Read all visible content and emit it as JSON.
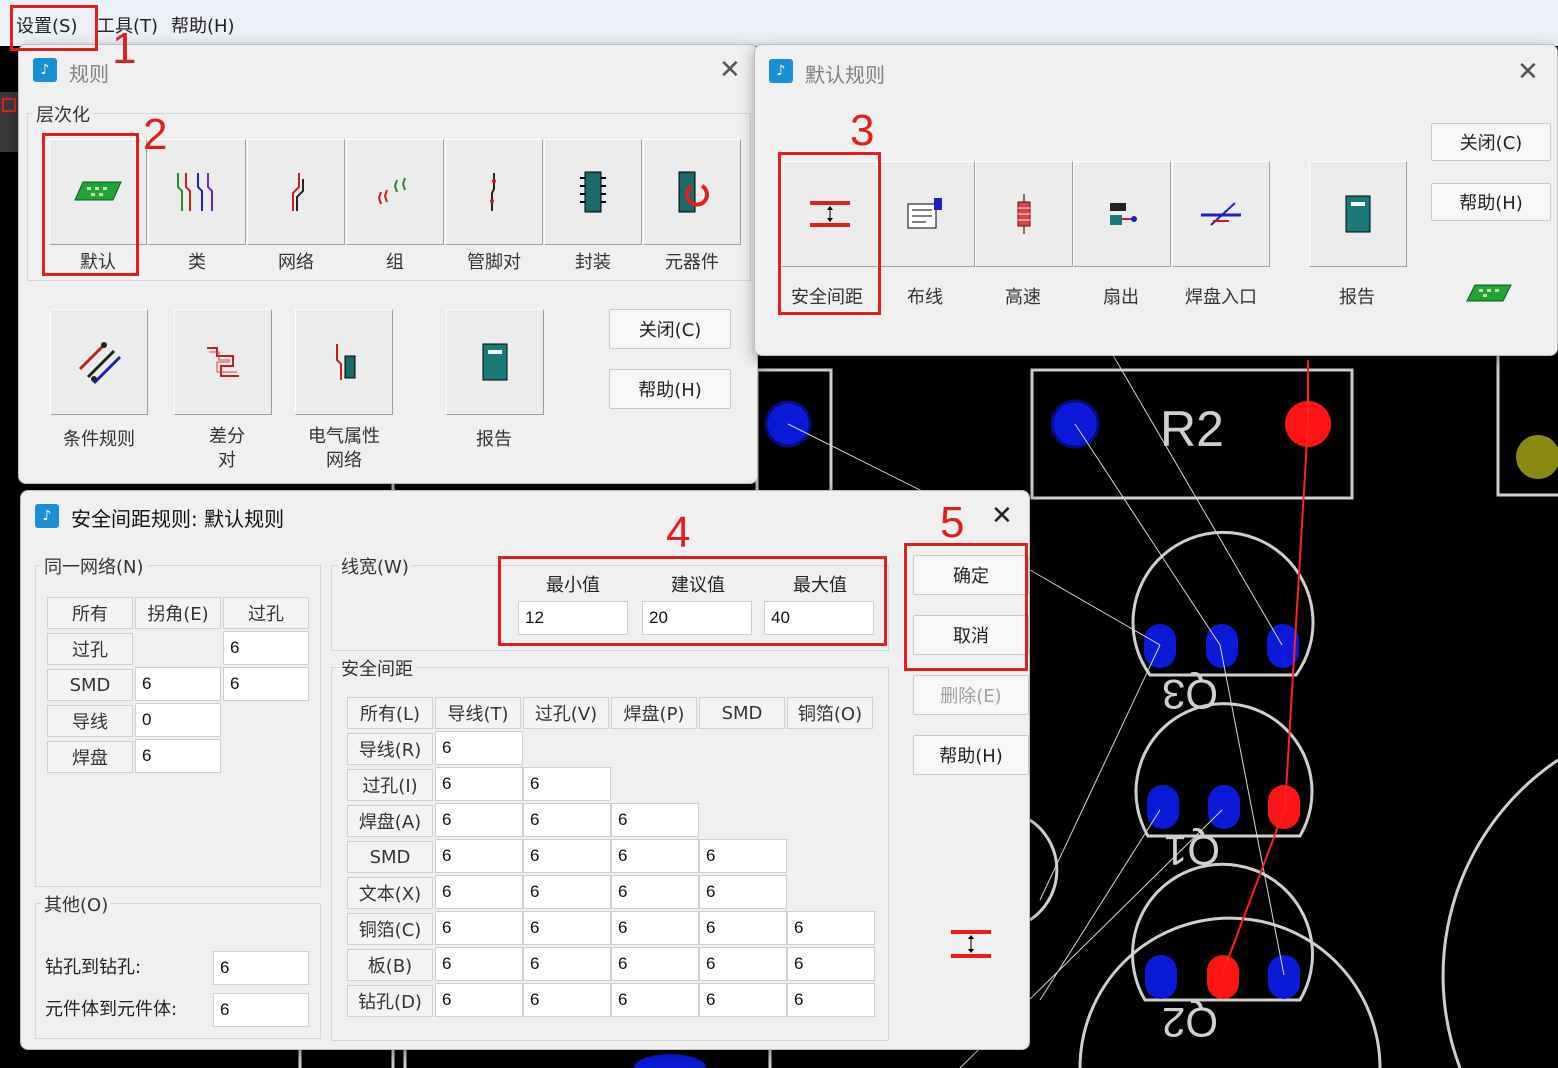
{
  "menubar": {
    "items": [
      "设置(S)",
      "工具(T)",
      "帮助(H)"
    ]
  },
  "annotations": {
    "steps": [
      "1",
      "2",
      "3",
      "4",
      "5"
    ]
  },
  "pcb": {
    "labels": [
      "R2",
      "Q3",
      "Q1",
      "Q2"
    ],
    "colors": {
      "pad_blue": "#0b1ad8",
      "pad_red": "#ff1414",
      "outline": "#cfcfcf",
      "trace_red": "#ff2020"
    }
  },
  "rules_window": {
    "title": "规则",
    "group_label": "层次化",
    "tiles_row1": [
      "默认",
      "类",
      "网络",
      "组",
      "管脚对",
      "封装",
      "元器件"
    ],
    "tiles_row2": [
      "条件规则",
      "差分\n对",
      "电气属性\n网络",
      "报告"
    ],
    "close_button": "关闭(C)",
    "help_button": "帮助(H)"
  },
  "default_rules_window": {
    "title": "默认规则",
    "tiles": [
      "安全间距",
      "布线",
      "高速",
      "扇出",
      "焊盘入口",
      "报告"
    ],
    "close_button": "关闭(C)",
    "help_button": "帮助(H)"
  },
  "clearance_dialog": {
    "title": "安全间距规则: 默认规则",
    "same_net": {
      "label": "同一网络(N)",
      "headers": [
        "所有",
        "拐角(E)",
        "过孔"
      ],
      "rows": [
        {
          "label": "过孔",
          "values": [
            "",
            "6"
          ]
        },
        {
          "label": "SMD",
          "values": [
            "6",
            "6"
          ]
        },
        {
          "label": "导线",
          "values": [
            "0",
            ""
          ]
        },
        {
          "label": "焊盘",
          "values": [
            "6",
            ""
          ]
        }
      ]
    },
    "other": {
      "label": "其他(O)",
      "drill_to_drill_label": "钻孔到钻孔:",
      "drill_to_drill": "6",
      "body_to_body_label": "元件体到元件体:",
      "body_to_body": "6"
    },
    "trace_width": {
      "label": "线宽(W)",
      "min_label": "最小值",
      "rec_label": "建议值",
      "max_label": "最大值",
      "min": "12",
      "rec": "20",
      "max": "40"
    },
    "clearance": {
      "label": "安全间距",
      "headers": [
        "所有(L)",
        "导线(T)",
        "过孔(V)",
        "焊盘(P)",
        "SMD",
        "铜箔(O)"
      ],
      "rows": [
        {
          "label": "导线(R)",
          "values": [
            "6"
          ]
        },
        {
          "label": "过孔(I)",
          "values": [
            "6",
            "6"
          ]
        },
        {
          "label": "焊盘(A)",
          "values": [
            "6",
            "6",
            "6"
          ]
        },
        {
          "label": "SMD",
          "values": [
            "6",
            "6",
            "6",
            "6"
          ]
        },
        {
          "label": "文本(X)",
          "values": [
            "6",
            "6",
            "6",
            "6"
          ]
        },
        {
          "label": "铜箔(C)",
          "values": [
            "6",
            "6",
            "6",
            "6",
            "6"
          ]
        },
        {
          "label": "板(B)",
          "values": [
            "6",
            "6",
            "6",
            "6",
            "6"
          ]
        },
        {
          "label": "钻孔(D)",
          "values": [
            "6",
            "6",
            "6",
            "6",
            "6"
          ]
        }
      ]
    },
    "buttons": {
      "ok": "确定",
      "cancel": "取消",
      "delete": "删除(E)",
      "help": "帮助(H)"
    }
  }
}
